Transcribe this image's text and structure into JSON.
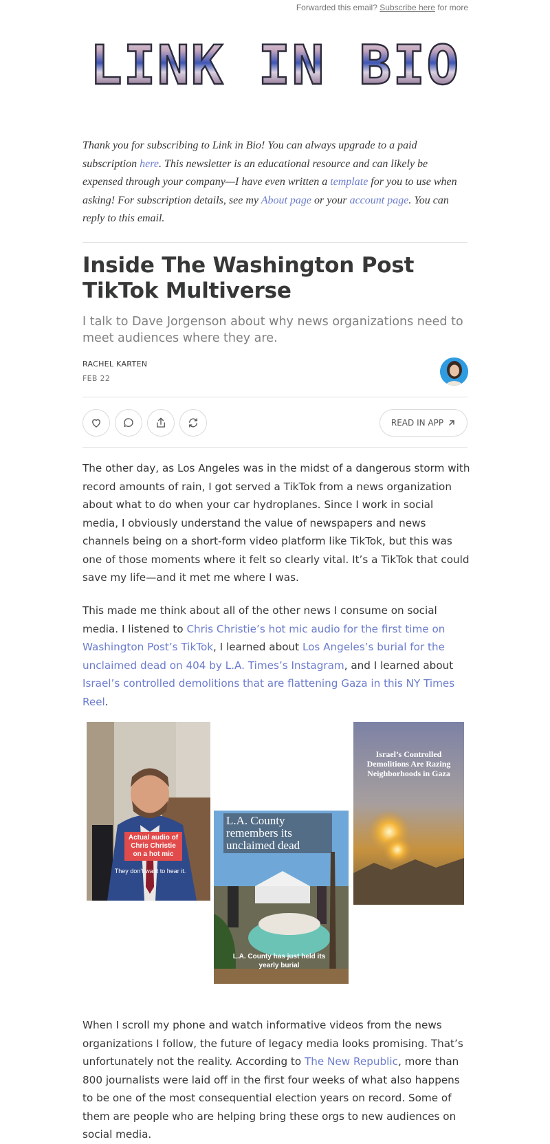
{
  "header": {
    "forwarded": "Forwarded this email?",
    "subscribe_link": "Subscribe here",
    "for_more": "for more",
    "logo_text": "LINK IN BIO"
  },
  "intro": {
    "t1": "Thank you for subscribing to Link in Bio! You can always upgrade to a paid subscription ",
    "l1": "here",
    "t2": ". This newsletter is an educational resource and can likely be expensed through your company—I have even written a ",
    "l2": "template",
    "t3": " for you to use when asking! For subscription details, see my ",
    "l3": "About page",
    "t4": " or your ",
    "l4": "account page",
    "t5": ". You can reply to this email."
  },
  "post": {
    "title": "Inside The Washington Post TikTok Multiverse",
    "subtitle": "I talk to Dave Jorgenson about why news organizations need to meet audiences where they are.",
    "author": "RACHEL KARTEN",
    "date": "FEB 22"
  },
  "actions": {
    "like_icon": "heart-icon",
    "comment_icon": "comment-icon",
    "share_icon": "share-icon",
    "restack_icon": "restack-icon",
    "read_in_app": "READ IN APP"
  },
  "body": {
    "p1": "The other day, as Los Angeles was in the midst of a dangerous storm with record amounts of rain, I got served a TikTok from a news organization about what to do when your car hydroplanes. Since I work in social media, I obviously understand the value of newspapers and news channels being on a short-form video platform like TikTok, but this was one of those moments where it felt so clearly vital. It’s a TikTok that could save my life—and it met me where I was.",
    "p2_t1": "This made me think about all of the other news I consume on social media. I listened to ",
    "p2_l1": "Chris Christie’s hot mic audio for the first time on Washington Post’s TikTok",
    "p2_t2": ", I learned about ",
    "p2_l2": "Los Angeles’s burial for the unclaimed dead on 404 by L.A. Times’s Instagram",
    "p2_t3": ", and I learned about ",
    "p2_l3": "Israel’s controlled demolitions that are flattening Gaza in this NY Times Reel",
    "p2_t4": ".",
    "p3_t1": "When I scroll my phone and watch informative videos from the news organizations I follow, the future of legacy media looks promising. That’s unfortunately not the reality. According to ",
    "p3_l1": "The New Republic",
    "p3_t2": ", more than 800 journalists were laid off in the first four weeks of what also happens to be one of the most consequential election years on record. Some of them are people who are helping bring these orgs to new audiences on social media."
  },
  "images": {
    "wapo_caption": "Actual audio of Chris Christie on a hot mic",
    "wapo_subtitle": "They don’t want to hear it.",
    "latimes_title": "L.A. County remembers its unclaimed dead",
    "latimes_subtitle": "L.A. County has just held its yearly burial",
    "nyt_title": "Israel’s Controlled Demolitions Are Razing Neighborhoods in Gaza"
  },
  "colors": {
    "link": "#6b7ccd",
    "text": "#363737",
    "muted": "#808080",
    "divider": "#e0e0e0"
  }
}
